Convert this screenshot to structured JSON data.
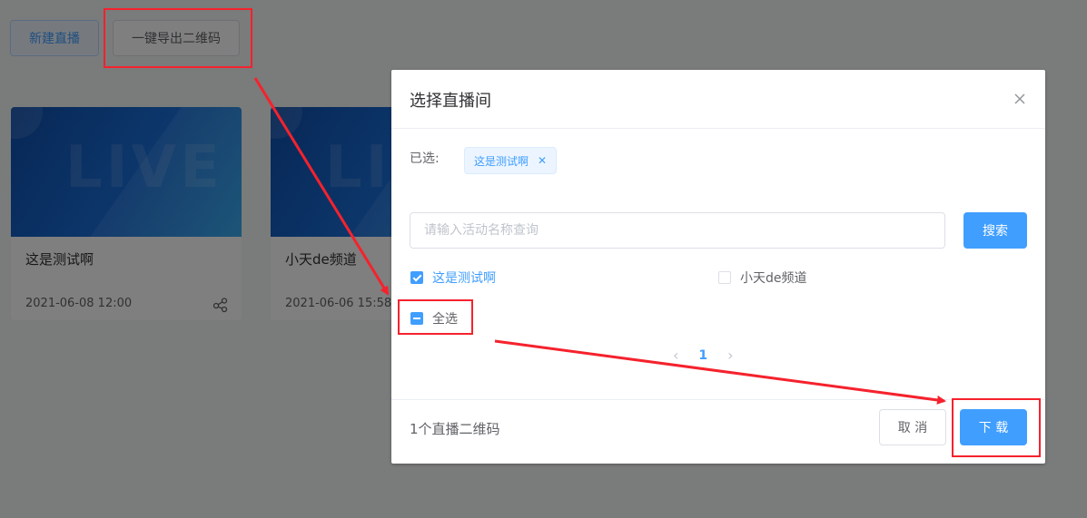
{
  "page": {
    "new_live_label": "新建直播",
    "export_qr_label": "一键导出二维码",
    "cards": [
      {
        "title": "这是测试啊",
        "date": "2021-06-08 12:00"
      },
      {
        "title": "小天de频道",
        "date": "2021-06-06 15:58"
      }
    ],
    "thumb_text": "LIVE"
  },
  "dialog": {
    "title": "选择直播间",
    "selected_label": "已选:",
    "selected_tags": [
      "这是测试啊"
    ],
    "search": {
      "placeholder": "请输入活动名称查询",
      "value": "",
      "button_label": "搜索"
    },
    "options": [
      {
        "label": "这是测试啊",
        "checked": true
      },
      {
        "label": "小天de频道",
        "checked": false
      }
    ],
    "select_all_label": "全选",
    "pagination": {
      "current": "1"
    },
    "footer": {
      "count_text": "1个直播二维码",
      "cancel_label": "取 消",
      "download_label": "下 载"
    }
  },
  "colors": {
    "primary": "#409eff",
    "annotation": "#f5222d"
  }
}
